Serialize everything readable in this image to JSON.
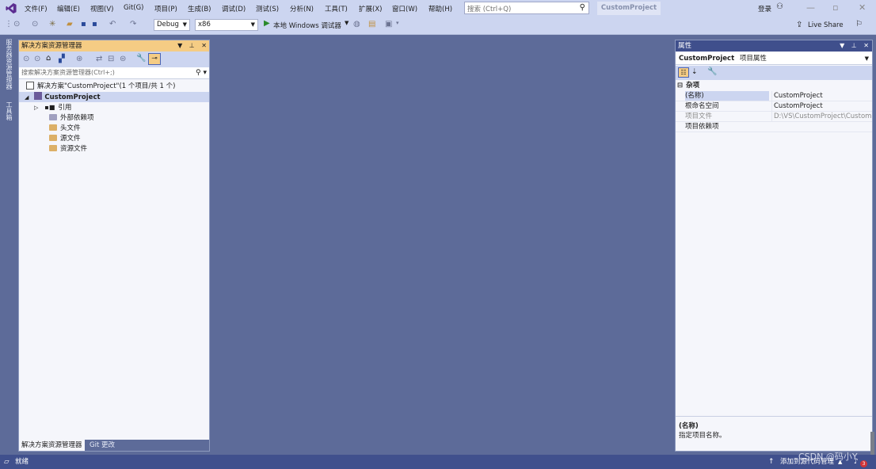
{
  "menu": [
    "文件(F)",
    "编辑(E)",
    "视图(V)",
    "Git(G)",
    "项目(P)",
    "生成(B)",
    "调试(D)",
    "测试(S)",
    "分析(N)",
    "工具(T)",
    "扩展(X)",
    "窗口(W)",
    "帮助(H)"
  ],
  "search": {
    "placeholder": "搜索 (Ctrl+Q)"
  },
  "title_badge": "CustomProject",
  "login": "登录",
  "toolbar": {
    "config": "Debug",
    "platform": "x86",
    "run_label": "本地 Windows 调试器",
    "live_share": "Live Share"
  },
  "left_strip": [
    "服务器资源管理器",
    "工具箱"
  ],
  "solution_explorer": {
    "title": "解决方案资源管理器",
    "search_placeholder": "搜索解决方案资源管理器(Ctrl+;)",
    "solution_label": "解决方案\"CustomProject\"(1 个项目/共 1 个)",
    "project": "CustomProject",
    "items": [
      "引用",
      "外部依赖项",
      "头文件",
      "源文件",
      "资源文件"
    ],
    "tabs": [
      "解决方案资源管理器",
      "Git 更改"
    ]
  },
  "properties": {
    "title": "属性",
    "object_name": "CustomProject",
    "object_type": "项目属性",
    "category": "杂项",
    "rows": [
      {
        "k": "(名称)",
        "v": "CustomProject"
      },
      {
        "k": "根命名空间",
        "v": "CustomProject"
      },
      {
        "k": "项目文件",
        "v": "D:\\VS\\CustomProject\\CustomPr"
      },
      {
        "k": "项目依赖项",
        "v": ""
      }
    ],
    "desc_title": "(名称)",
    "desc_text": "指定项目名称。"
  },
  "status": {
    "ready": "就绪",
    "add_source": "添加到源代码管理",
    "watermark": "CSDN @码小Y",
    "notif_count": "3"
  },
  "colors": {
    "accent": "#40508d",
    "editor_bg": "#5d6b99",
    "toolwin_header": "#f5cc84"
  }
}
